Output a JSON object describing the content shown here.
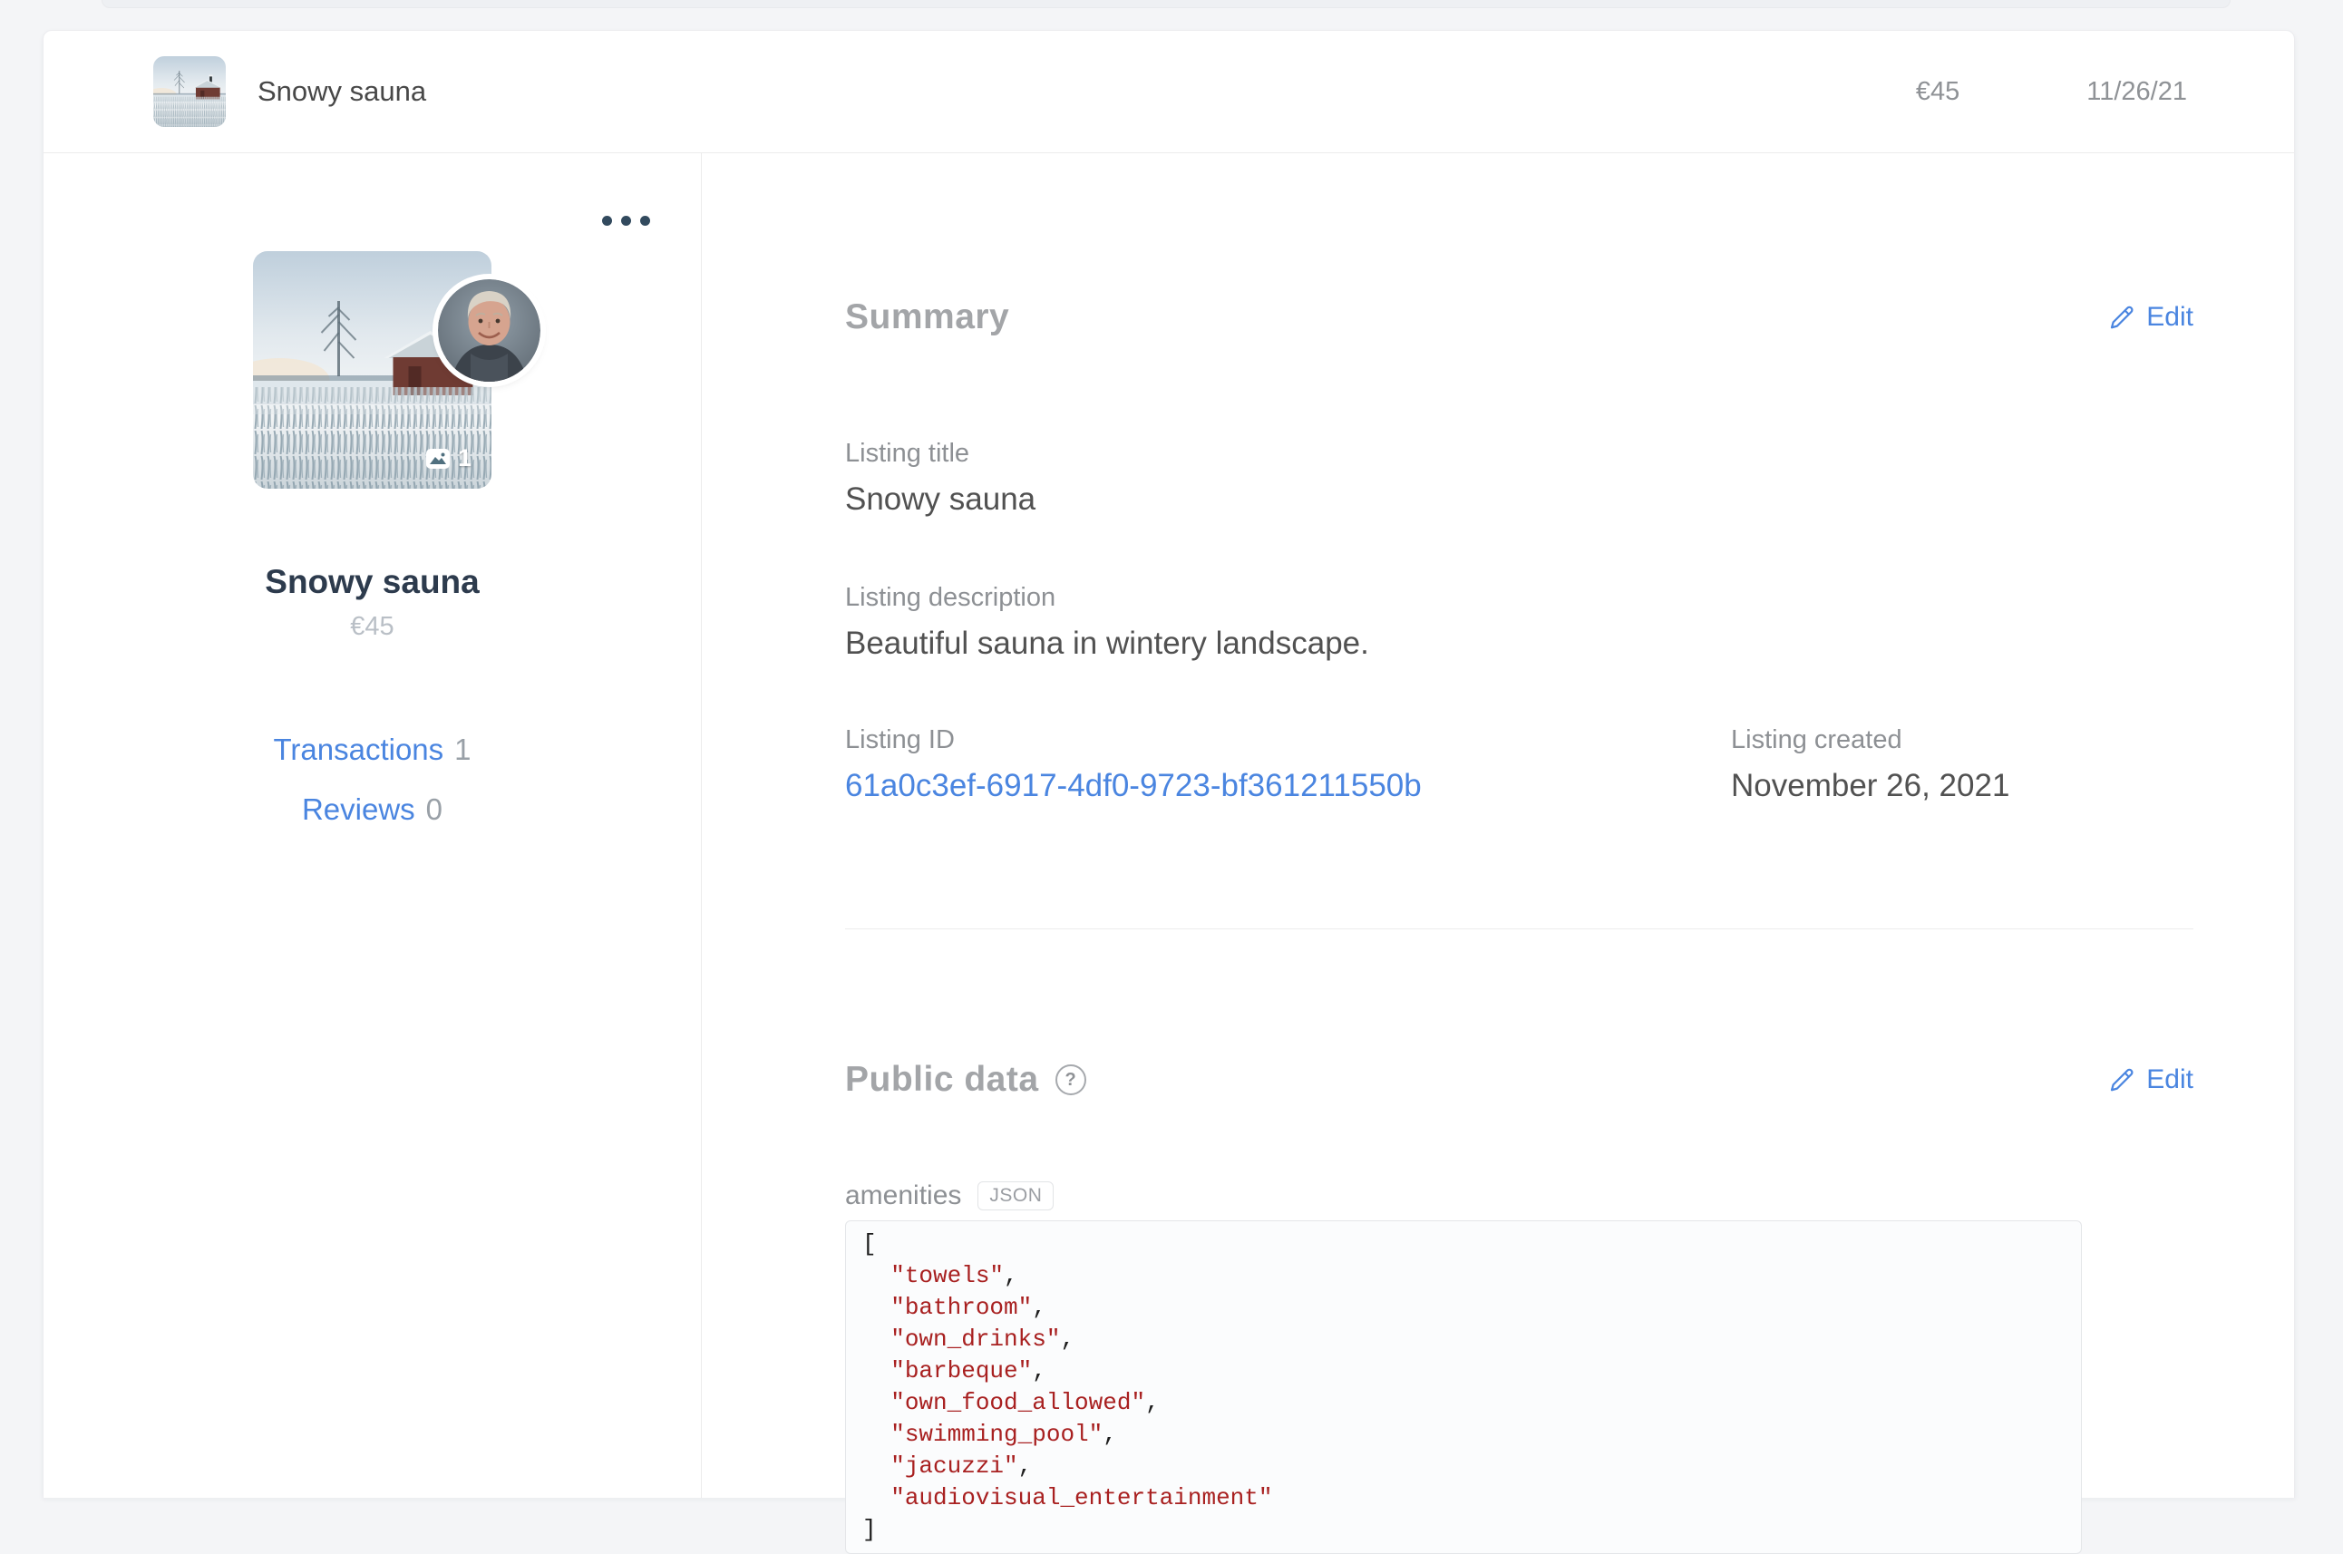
{
  "header": {
    "title": "Snowy sauna",
    "price": "€45",
    "date": "11/26/21"
  },
  "sidebar": {
    "image_count": "1",
    "title": "Snowy sauna",
    "price": "€45",
    "links": [
      {
        "label": "Transactions",
        "count": "1"
      },
      {
        "label": "Reviews",
        "count": "0"
      }
    ]
  },
  "summary": {
    "heading": "Summary",
    "edit_label": "Edit",
    "fields": {
      "title": {
        "label": "Listing title",
        "value": "Snowy sauna"
      },
      "description": {
        "label": "Listing description",
        "value": "Beautiful sauna in wintery landscape."
      },
      "id": {
        "label": "Listing ID",
        "value": "61a0c3ef-6917-4df0-9723-bf361211550b"
      },
      "created": {
        "label": "Listing created",
        "value": "November 26, 2021"
      }
    }
  },
  "public_data": {
    "heading": "Public data",
    "help_icon": "?",
    "edit_label": "Edit",
    "field_name": "amenities",
    "badge_label": "JSON",
    "amenities": [
      "towels",
      "bathroom",
      "own_drinks",
      "barbeque",
      "own_food_allowed",
      "swimming_pool",
      "jacuzzi",
      "audiovisual_entertainment"
    ]
  },
  "colors": {
    "accent_blue": "#4a85e0",
    "code_string_red": "#a82020",
    "slate_dark": "#2d3b4d",
    "heading_grey": "#a3a5a8"
  }
}
